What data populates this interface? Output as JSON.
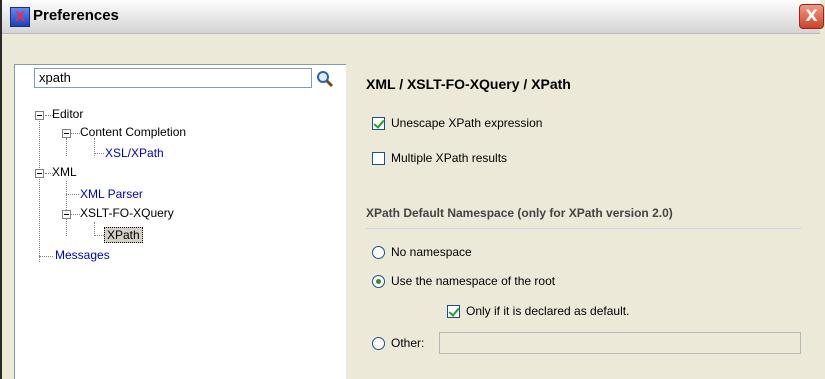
{
  "window": {
    "title": "Preferences",
    "close_glyph": "X",
    "app_icon_glyph": "X"
  },
  "search": {
    "value": "xpath",
    "icon": "search-icon"
  },
  "tree": {
    "editor": "Editor",
    "content_completion": "Content Completion",
    "xsl_xpath": "XSL/XPath",
    "xml": "XML",
    "xml_parser": "XML Parser",
    "xslt_fo_xquery": "XSLT-FO-XQuery",
    "xpath": "XPath",
    "messages": "Messages"
  },
  "page": {
    "title": "XML / XSLT-FO-XQuery / XPath",
    "unescape_label": "Unescape XPath expression",
    "unescape_checked": true,
    "multiple_label": "Multiple XPath results",
    "multiple_checked": false,
    "namespace_section": "XPath Default Namespace (only for XPath version 2.0)",
    "no_namespace_label": "No namespace",
    "use_root_label": "Use the namespace of the root",
    "selected_namespace": "use-root",
    "only_declared_label": "Only if it is declared as default.",
    "only_declared_checked": true,
    "other_label": "Other:",
    "other_value": ""
  }
}
